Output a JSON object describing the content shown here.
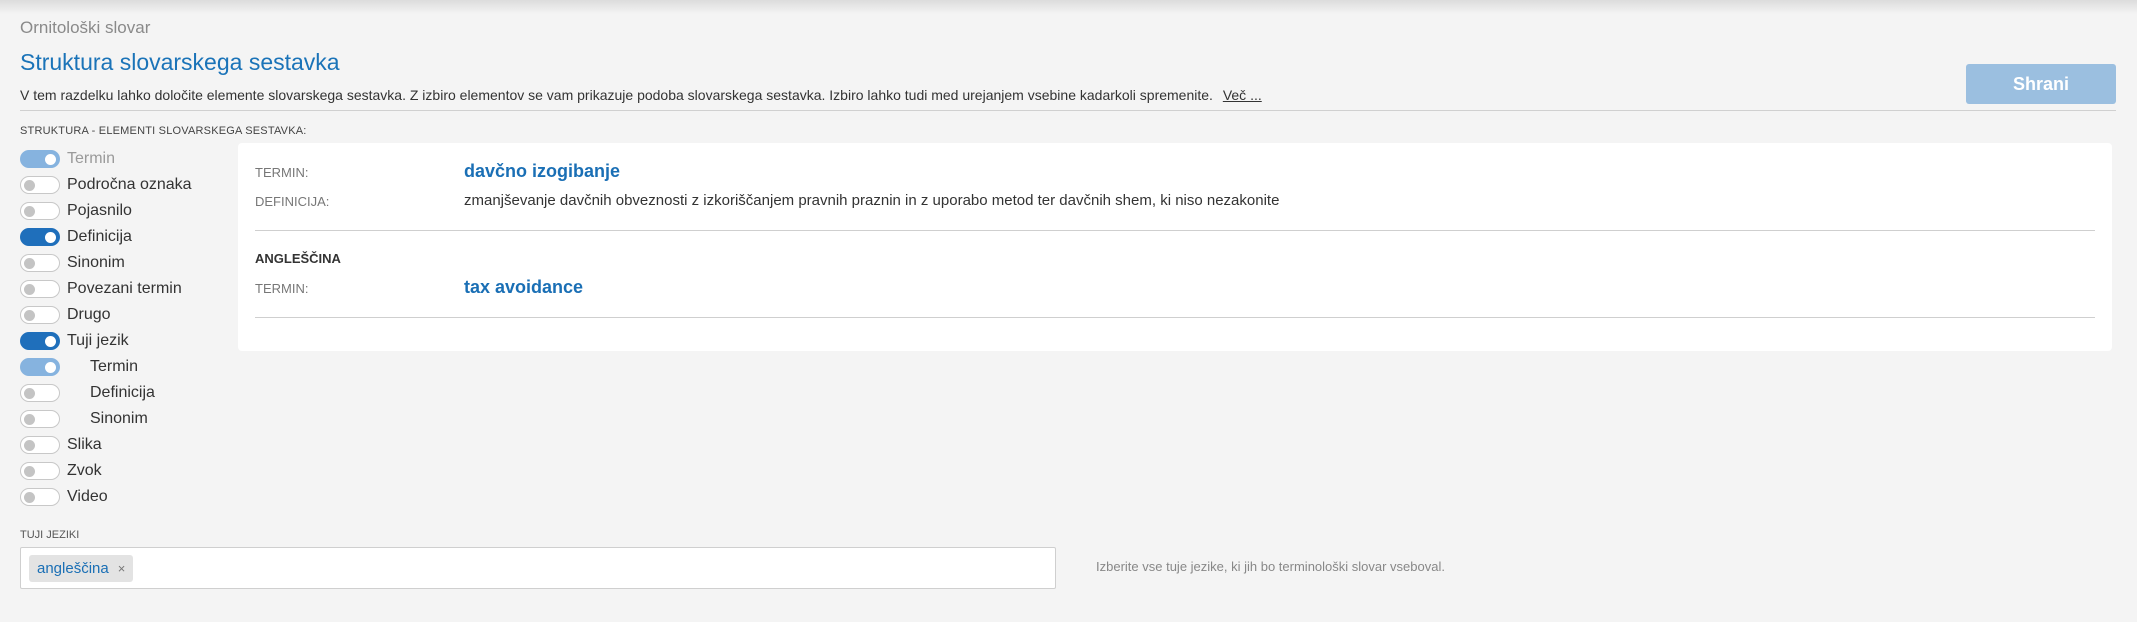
{
  "breadcrumb": "Ornitološki slovar",
  "title": "Struktura slovarskega sestavka",
  "description": "V tem razdelku lahko določite elemente slovarskega sestavka. Z izbiro elementov se vam prikazuje podoba slovarskega sestavka. Izbiro lahko tudi med urejanjem vsebine kadarkoli spremenite.",
  "more_link": "Več ...",
  "save_label": "Shrani",
  "structure_label": "STRUKTURA - ELEMENTI SLOVARSKEGA SESTAVKA:",
  "toggles": [
    {
      "label": "Termin",
      "on": true
    },
    {
      "label": "Področna oznaka",
      "on": false
    },
    {
      "label": "Pojasnilo",
      "on": false
    },
    {
      "label": "Definicija",
      "on": true
    },
    {
      "label": "Sinonim",
      "on": false
    },
    {
      "label": "Povezani termin",
      "on": false
    },
    {
      "label": "Drugo",
      "on": false
    },
    {
      "label": "Tuji jezik",
      "on": true
    },
    {
      "label": "Termin",
      "on": true
    },
    {
      "label": "Definicija",
      "on": false
    },
    {
      "label": "Sinonim",
      "on": false
    },
    {
      "label": "Slika",
      "on": false
    },
    {
      "label": "Zvok",
      "on": false
    },
    {
      "label": "Video",
      "on": false
    }
  ],
  "preview": {
    "term_label": "TERMIN:",
    "term": "davčno izogibanje",
    "definition_label": "DEFINICIJA:",
    "definition": "zmanjševanje davčnih obveznosti z izkoriščanjem pravnih praznin in z uporabo metod ter davčnih shem, ki niso nezakonite",
    "language_heading": "ANGLEŠČINA",
    "foreign_term_label": "TERMIN:",
    "foreign_term": "tax avoidance"
  },
  "languages": {
    "label": "TUJI JEZIKI",
    "selected": [
      "angleščina"
    ],
    "remove_symbol": "×",
    "help": "Izberite vse tuje jezike, ki jih bo terminološki slovar vseboval."
  },
  "colors": {
    "accent": "#1a73b8",
    "toggle_on": "#1f6fbb",
    "toggle_on_light": "#86b3df",
    "save_button": "#9bbfe0"
  }
}
